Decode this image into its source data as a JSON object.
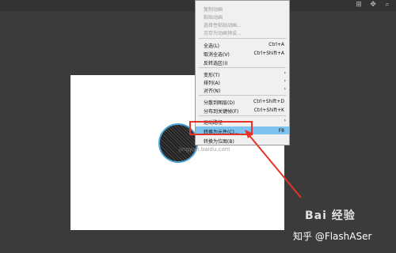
{
  "menu": {
    "items": [
      {
        "label": "复制动画",
        "shortcut": "",
        "submenu": false,
        "disabled": true
      },
      {
        "label": "粘贴动画",
        "shortcut": "",
        "submenu": false,
        "disabled": true
      },
      {
        "label": "选择性粘贴动画...",
        "shortcut": "",
        "submenu": false,
        "disabled": true
      },
      {
        "label": "另存为动画预设...",
        "shortcut": "",
        "submenu": false,
        "disabled": true
      },
      {
        "label": "全选(L)",
        "shortcut": "Ctrl+A",
        "submenu": false,
        "disabled": false
      },
      {
        "label": "取消全选(V)",
        "shortcut": "Ctrl+Shift+A",
        "submenu": false,
        "disabled": false
      },
      {
        "label": "反转选区(I)",
        "shortcut": "",
        "submenu": false,
        "disabled": false
      },
      {
        "label": "变形(T)",
        "shortcut": "",
        "submenu": true,
        "disabled": false
      },
      {
        "label": "排列(A)",
        "shortcut": "",
        "submenu": true,
        "disabled": false
      },
      {
        "label": "对齐(N)",
        "shortcut": "",
        "submenu": true,
        "disabled": false
      },
      {
        "label": "分散到图层(D)",
        "shortcut": "Ctrl+Shift+D",
        "submenu": false,
        "disabled": false
      },
      {
        "label": "分布到关键帧(F)",
        "shortcut": "Ctrl+Shift+K",
        "submenu": false,
        "disabled": false
      },
      {
        "label": "运动路径",
        "shortcut": "",
        "submenu": true,
        "disabled": false
      },
      {
        "label": "转换为元件(C)...",
        "shortcut": "F8",
        "submenu": false,
        "disabled": false
      },
      {
        "label": "转换为位图(B)",
        "shortcut": "",
        "submenu": false,
        "disabled": false
      }
    ]
  },
  "watermark": {
    "site": "jingyan.baidu.com",
    "baidu": "Bai 经验",
    "zhihu": "知乎 @FlashASer"
  },
  "colors": {
    "highlight": "#7ec3f0",
    "annotation": "#e5332a",
    "circle_stroke": "#4aa3d6"
  }
}
